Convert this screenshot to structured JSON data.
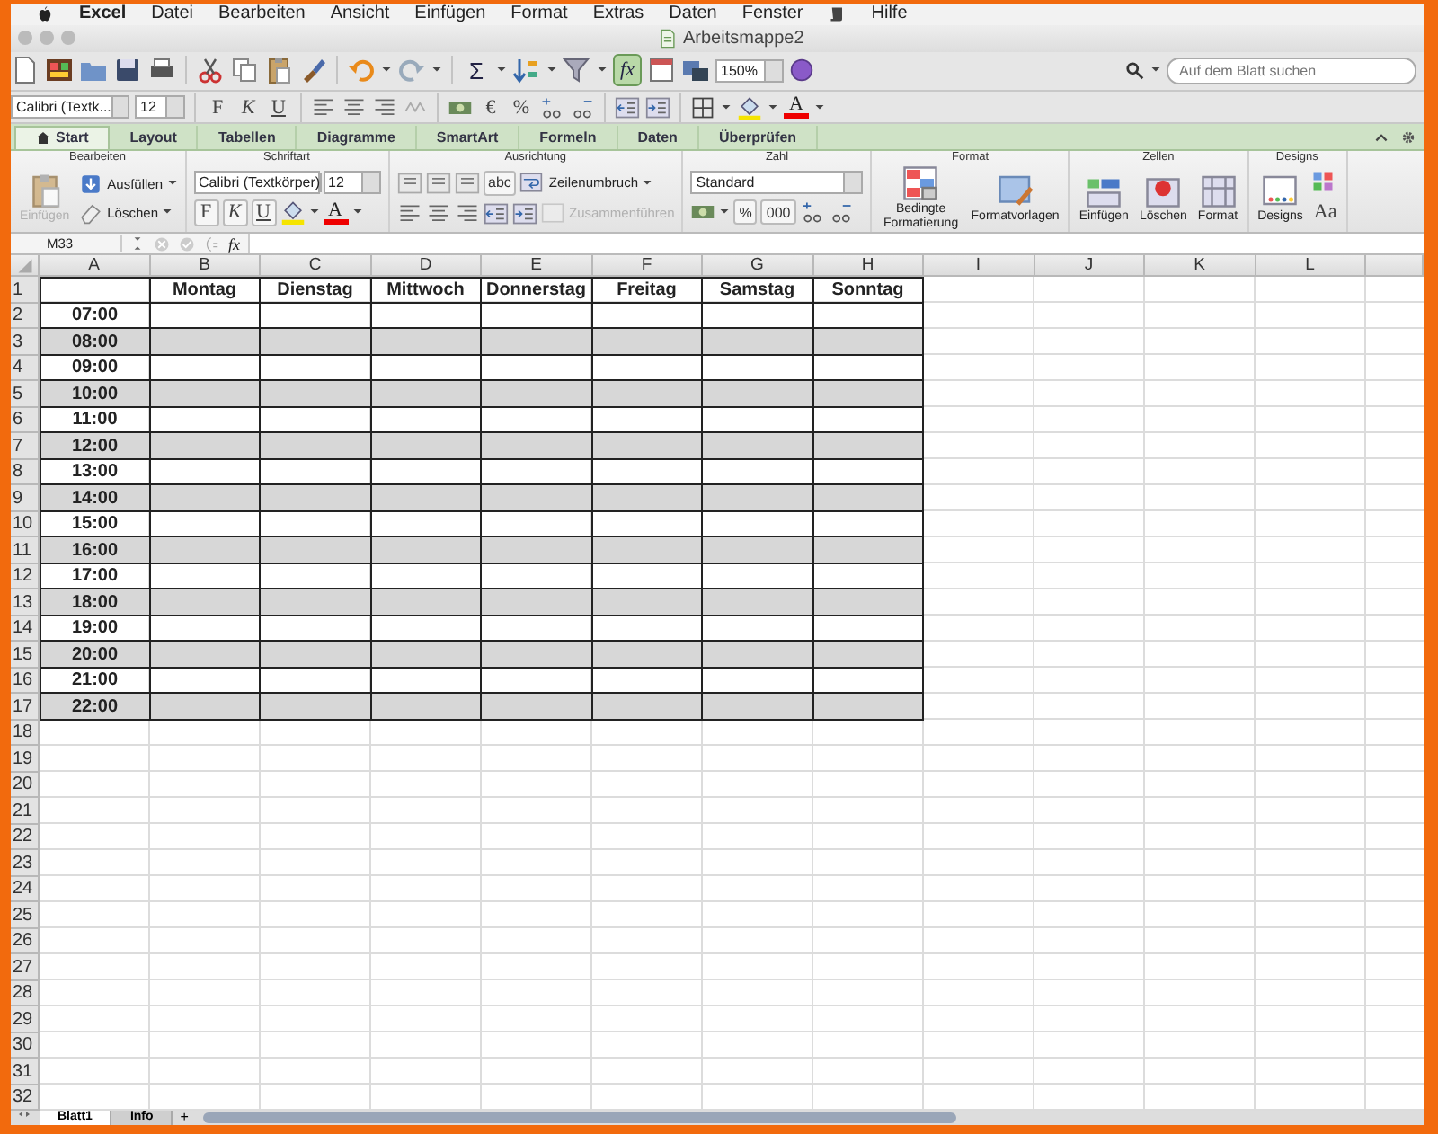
{
  "menu_bar": {
    "items": [
      "Excel",
      "Datei",
      "Bearbeiten",
      "Ansicht",
      "Einfügen",
      "Format",
      "Extras",
      "Daten",
      "Fenster",
      "Hilfe"
    ]
  },
  "window": {
    "title": "Arbeitsmappe2"
  },
  "standard_toolbar": {
    "sum": "Σ",
    "formula_builder": {
      "label": "fx",
      "on": true
    },
    "zoom": "150%"
  },
  "search": {
    "placeholder": "Auf dem Blatt suchen"
  },
  "format_toolbar": {
    "font": "Calibri (Textk...",
    "size": "12",
    "bold": "F",
    "italic": "K",
    "underline": "U",
    "currency": "€",
    "percent": "%",
    "font_color": "A"
  },
  "ribbon": {
    "tabs": [
      {
        "label": "Start",
        "selected": true
      },
      {
        "label": "Layout",
        "selected": false
      },
      {
        "label": "Tabellen",
        "selected": false
      },
      {
        "label": "Diagramme",
        "selected": false
      },
      {
        "label": "SmartArt",
        "selected": false
      },
      {
        "label": "Formeln",
        "selected": false
      },
      {
        "label": "Daten",
        "selected": false
      },
      {
        "label": "Überprüfen",
        "selected": false
      }
    ],
    "groups": [
      {
        "kind": "edit",
        "title": "Bearbeiten",
        "paste": {
          "label": "Einfügen",
          "disabled": true
        },
        "fill": "Ausfüllen",
        "clear": "Löschen"
      },
      {
        "kind": "font",
        "title": "Schriftart",
        "font": "Calibri (Textkörper)",
        "size": "12",
        "bold": "F",
        "italic": "K",
        "underline": "U",
        "font_color": "A"
      },
      {
        "kind": "align",
        "title": "Ausrichtung",
        "orientation": "abc",
        "wrap": "Zeilenumbruch",
        "merge": {
          "label": "Zusammenführen",
          "disabled": true
        }
      },
      {
        "kind": "number",
        "title": "Zahl",
        "format": "Standard",
        "percent": "%",
        "thousands": "000"
      },
      {
        "kind": "format",
        "title": "Format",
        "conditional": "Bedingte Formatierung",
        "styles": "Formatvorlagen"
      },
      {
        "kind": "cells",
        "title": "Zellen",
        "insert": "Einfügen",
        "delete": "Löschen",
        "format": "Format"
      },
      {
        "kind": "themes",
        "title": "Designs",
        "themes": "Designs",
        "fonts": "Aa"
      }
    ]
  },
  "formula_bar": {
    "cell_ref": "M33",
    "fx": "fx"
  },
  "sheet": {
    "columns": [
      "A",
      "B",
      "C",
      "D",
      "E",
      "F",
      "G",
      "H",
      "I",
      "J",
      "K",
      "L"
    ],
    "header_row": {
      "number": "1",
      "days": [
        "Montag",
        "Dienstag",
        "Mittwoch",
        "Donnerstag",
        "Freitag",
        "Samstag",
        "Sonntag"
      ]
    },
    "time_rows": [
      {
        "number": "2",
        "time": "07:00",
        "shaded": false
      },
      {
        "number": "3",
        "time": "08:00",
        "shaded": true
      },
      {
        "number": "4",
        "time": "09:00",
        "shaded": false
      },
      {
        "number": "5",
        "time": "10:00",
        "shaded": true
      },
      {
        "number": "6",
        "time": "11:00",
        "shaded": false
      },
      {
        "number": "7",
        "time": "12:00",
        "shaded": true
      },
      {
        "number": "8",
        "time": "13:00",
        "shaded": false
      },
      {
        "number": "9",
        "time": "14:00",
        "shaded": true
      },
      {
        "number": "10",
        "time": "15:00",
        "shaded": false
      },
      {
        "number": "11",
        "time": "16:00",
        "shaded": true
      },
      {
        "number": "12",
        "time": "17:00",
        "shaded": false
      },
      {
        "number": "13",
        "time": "18:00",
        "shaded": true
      },
      {
        "number": "14",
        "time": "19:00",
        "shaded": false
      },
      {
        "number": "15",
        "time": "20:00",
        "shaded": true
      },
      {
        "number": "16",
        "time": "21:00",
        "shaded": false
      },
      {
        "number": "17",
        "time": "22:00",
        "shaded": true
      }
    ],
    "empty_rows": [
      "18",
      "19",
      "20",
      "21",
      "22",
      "23",
      "24",
      "25",
      "26",
      "27",
      "28",
      "29",
      "30",
      "31",
      "32"
    ]
  },
  "sheet_tabs": [
    {
      "label": "Blatt1",
      "selected": true
    },
    {
      "label": "Info",
      "selected": false
    }
  ],
  "add_sheet": "+"
}
